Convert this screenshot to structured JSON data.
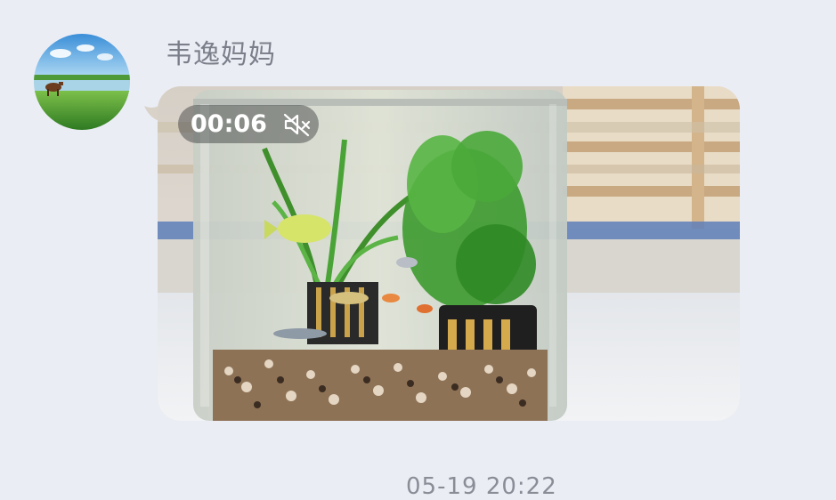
{
  "message": {
    "sender_name": "韦逸妈妈",
    "video": {
      "duration": "00:06",
      "muted": true,
      "description_icon": "mute-icon"
    },
    "timestamp": "05-19 20:22"
  },
  "colors": {
    "background": "#ebedf5",
    "sender_text": "#7b7f89",
    "timestamp_text": "#8a8d96",
    "overlay_pill": "rgba(40,42,46,0.42)"
  }
}
